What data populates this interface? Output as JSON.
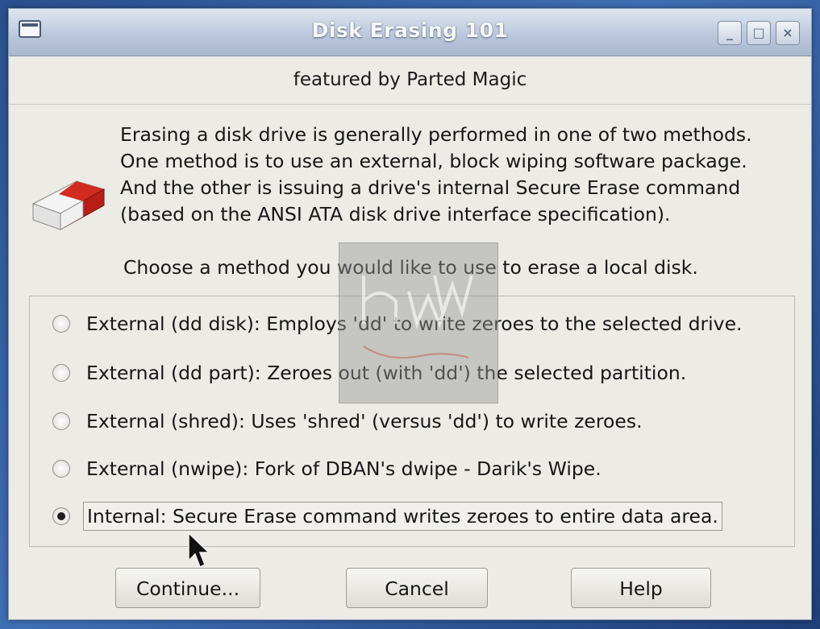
{
  "window": {
    "title": "Disk Erasing 101",
    "subtitle": "featured by Parted Magic",
    "controls": {
      "minimize": "_",
      "maximize": "□",
      "close": "×"
    }
  },
  "description": {
    "lines": [
      "Erasing a disk drive is generally performed in one of two methods.",
      "One method is to use an external, block wiping software package.",
      "And the other is issuing a drive's internal Secure Erase command",
      "(based on the ANSI ATA disk drive interface specification)."
    ],
    "prompt": "Choose a method you would like to use to erase a local disk."
  },
  "options": [
    {
      "label": "External (dd disk): Employs 'dd' to write zeroes to the selected drive.",
      "selected": false
    },
    {
      "label": "External (dd part): Zeroes out (with 'dd') the selected partition.",
      "selected": false
    },
    {
      "label": "External (shred): Uses 'shred' (versus 'dd') to write zeroes.",
      "selected": false
    },
    {
      "label": "External (nwipe): Fork of DBAN's dwipe - Darik's Wipe.",
      "selected": false
    },
    {
      "label": "Internal: Secure Erase command writes zeroes to entire data area.",
      "selected": true
    }
  ],
  "buttons": {
    "continue": "Continue...",
    "cancel": "Cancel",
    "help": "Help"
  },
  "icons": {
    "app": "eraser-icon",
    "window_menu": "window-menu-icon",
    "watermark": "hw-legend-watermark"
  },
  "colors": {
    "eraser_red": "#d22b1f",
    "titlebar": "#b9c6db",
    "window_bg": "#ecebe6"
  }
}
